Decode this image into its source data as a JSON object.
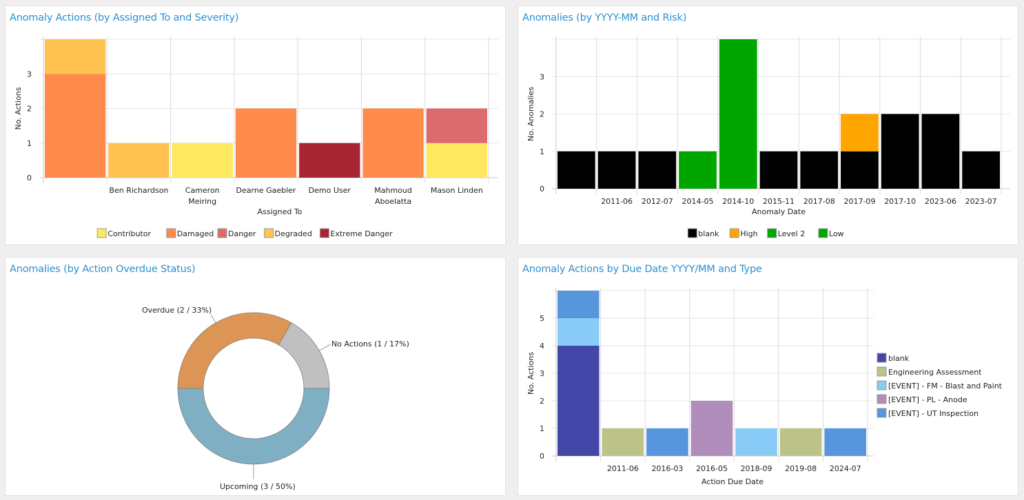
{
  "chart_data": [
    {
      "id": "assigned",
      "type": "bar",
      "stacked": true,
      "title": "Anomaly Actions (by Assigned To and Severity)",
      "xlabel": "Assigned To",
      "ylabel": "No. Actions",
      "ylim": [
        0,
        4
      ],
      "yticks": [
        0,
        1,
        2,
        3
      ],
      "grid": true,
      "legend_position": "bottom",
      "categories": [
        "",
        [
          "Ben Richardson"
        ],
        [
          "Cameron",
          "Meiring"
        ],
        [
          "Dearne Gaebler"
        ],
        [
          "Demo User"
        ],
        [
          "Mahmoud",
          "Aboelatta"
        ],
        [
          "Mason Linden"
        ]
      ],
      "series": [
        {
          "name": "Contributor",
          "color": "#fde85f",
          "values": [
            0,
            0,
            1,
            0,
            0,
            0,
            1
          ]
        },
        {
          "name": "Damaged",
          "color": "#fe8b4b",
          "values": [
            3,
            0,
            0,
            2,
            0,
            2,
            0
          ]
        },
        {
          "name": "Danger",
          "color": "#dc6b70",
          "values": [
            0,
            0,
            0,
            0,
            0,
            0,
            1
          ]
        },
        {
          "name": "Degraded",
          "color": "#fec350",
          "values": [
            1,
            1,
            0,
            0,
            0,
            0,
            0
          ]
        },
        {
          "name": "Extreme Danger",
          "color": "#a82533",
          "values": [
            0,
            0,
            0,
            0,
            1,
            0,
            0
          ]
        }
      ]
    },
    {
      "id": "risk",
      "type": "bar",
      "stacked": true,
      "title": "Anomalies (by YYYY-MM and Risk)",
      "xlabel": "Anomaly Date",
      "ylabel": "No. Anomalies",
      "ylim": [
        0,
        4
      ],
      "yticks": [
        0,
        1,
        2,
        3
      ],
      "grid": true,
      "legend_position": "bottom",
      "categories": [
        "",
        [
          "2011-06"
        ],
        [
          "2012-07"
        ],
        [
          "2014-05"
        ],
        [
          "2014-10"
        ],
        [
          "2015-11"
        ],
        [
          "2017-08"
        ],
        [
          "2017-09"
        ],
        [
          "2017-10"
        ],
        [
          "2023-06"
        ],
        [
          "2023-07"
        ]
      ],
      "series": [
        {
          "name": "blank",
          "color": "#000000",
          "values": [
            1,
            1,
            1,
            0,
            0,
            1,
            1,
            1,
            2,
            2,
            1
          ]
        },
        {
          "name": "High",
          "color": "#fea500",
          "values": [
            0,
            0,
            0,
            0,
            0,
            0,
            0,
            1,
            0,
            0,
            0
          ]
        },
        {
          "name": "Level 2",
          "color": "#00a600",
          "values": [
            0,
            0,
            0,
            0,
            0,
            0,
            0,
            0,
            0,
            0,
            0
          ]
        },
        {
          "name": "Low",
          "color": "#00a600",
          "values": [
            0,
            0,
            0,
            1,
            4,
            0,
            0,
            0,
            0,
            0,
            0
          ]
        }
      ]
    },
    {
      "id": "overdue",
      "type": "pie",
      "donut": true,
      "title": "Anomalies (by Action Overdue Status)",
      "slices": [
        {
          "name": "Overdue",
          "value": 2,
          "percent": 33,
          "label": "Overdue (2 / 33%)",
          "color": "#dc9554"
        },
        {
          "name": "No Actions",
          "value": 1,
          "percent": 17,
          "label": "No Actions (1 / 17%)",
          "color": "#c0c0c0"
        },
        {
          "name": "Upcoming",
          "value": 3,
          "percent": 50,
          "label": "Upcoming (3 / 50%)",
          "color": "#7fafc3"
        }
      ]
    },
    {
      "id": "duedate",
      "type": "bar",
      "stacked": true,
      "title": "Anomaly Actions by Due Date YYYY/MM and Type",
      "xlabel": "Action Due Date",
      "ylabel": "No. Actions",
      "ylim": [
        0,
        6
      ],
      "yticks": [
        0,
        1,
        2,
        3,
        4,
        5
      ],
      "grid": true,
      "legend_position": "right",
      "categories": [
        "",
        [
          "2011-06"
        ],
        [
          "2016-03"
        ],
        [
          "2016-05"
        ],
        [
          "2018-09"
        ],
        [
          "2019-08"
        ],
        [
          "2024-07"
        ]
      ],
      "series": [
        {
          "name": "blank",
          "color": "#4347a8",
          "values": [
            4,
            0,
            0,
            0,
            0,
            0,
            0
          ]
        },
        {
          "name": "Engineering Assessment",
          "color": "#bbc388",
          "values": [
            0,
            1,
            0,
            0,
            0,
            1,
            0
          ]
        },
        {
          "name": "[EVENT] - FM - Blast and Paint",
          "color": "#88cbf7",
          "values": [
            1,
            0,
            0,
            0,
            1,
            0,
            0
          ]
        },
        {
          "name": "[EVENT] - PL - Anode",
          "color": "#b08dbb",
          "values": [
            0,
            0,
            0,
            2,
            0,
            0,
            0
          ]
        },
        {
          "name": "[EVENT] - UT Inspection",
          "color": "#5795dc",
          "values": [
            1,
            0,
            1,
            0,
            0,
            0,
            1
          ]
        }
      ]
    }
  ]
}
